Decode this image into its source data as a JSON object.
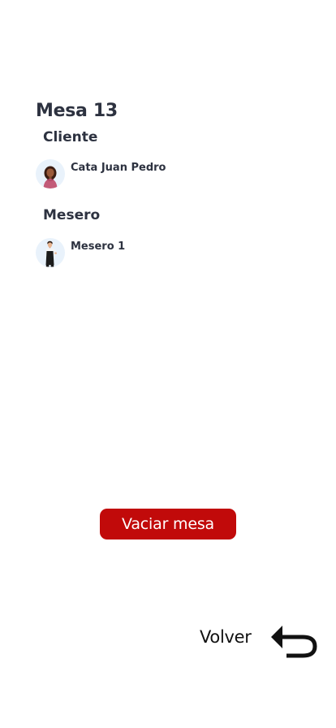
{
  "table": {
    "title": "Mesa 13"
  },
  "client": {
    "section_label": "Cliente",
    "name": "Cata Juan Pedro",
    "avatar_icon": "woman-avatar-icon"
  },
  "waiter": {
    "section_label": "Mesero",
    "name": "Mesero 1",
    "avatar_icon": "waiter-avatar-icon"
  },
  "actions": {
    "empty_table_label": "Vaciar mesa",
    "back_label": "Volver",
    "back_icon": "return-arrow-icon"
  },
  "colors": {
    "accent": "#c10a0a",
    "text": "#2d3240",
    "avatar_bg": "#e9f2fb"
  }
}
